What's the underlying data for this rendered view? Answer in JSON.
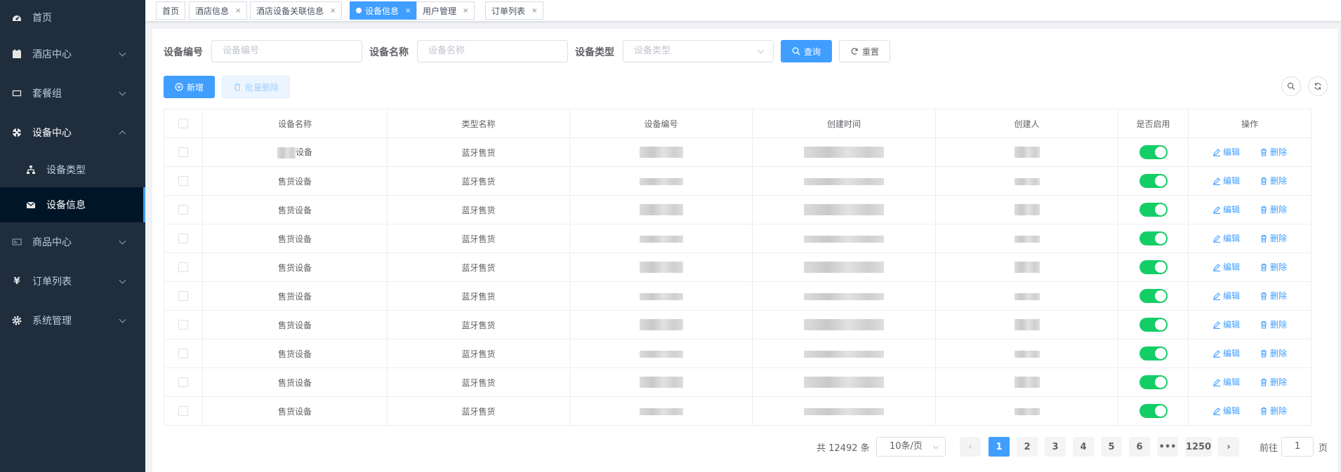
{
  "sidebar": {
    "items": [
      {
        "label": "首页",
        "icon": "dashboard-icon"
      },
      {
        "label": "酒店中心",
        "icon": "hotel-icon"
      },
      {
        "label": "套餐组",
        "icon": "package-icon"
      },
      {
        "label": "设备中心",
        "icon": "device-icon"
      },
      {
        "label": "商品中心",
        "icon": "goods-icon"
      },
      {
        "label": "订单列表",
        "icon": "yen-icon"
      },
      {
        "label": "系统管理",
        "icon": "gear-icon"
      }
    ],
    "sub_items": [
      {
        "label": "设备类型",
        "icon": "tree-icon"
      },
      {
        "label": "设备信息",
        "icon": "mail-icon"
      }
    ],
    "active_sub": "设备信息"
  },
  "tabs": [
    {
      "label": "首页"
    },
    {
      "label": "酒店信息"
    },
    {
      "label": "酒店设备关联信息"
    },
    {
      "label": "设备信息"
    },
    {
      "label": "用户管理"
    },
    {
      "label": "订单列表"
    }
  ],
  "filters": {
    "device_code_label": "设备编号",
    "device_code_placeholder": "设备编号",
    "device_name_label": "设备名称",
    "device_name_placeholder": "设备名称",
    "device_type_label": "设备类型",
    "device_type_placeholder": "设备类型",
    "search_label": "查询",
    "reset_label": "重置"
  },
  "toolbar": {
    "add_label": "新增",
    "batch_delete_label": "批量删除"
  },
  "table": {
    "columns": [
      "设备名称",
      "类型名称",
      "设备编号",
      "创建时间",
      "创建人",
      "是否启用",
      "操作"
    ],
    "rows": [
      {
        "name": "设备",
        "type": "蓝牙售货"
      },
      {
        "name": "售货设备",
        "type": "蓝牙售货"
      },
      {
        "name": "售货设备",
        "type": "蓝牙售货"
      },
      {
        "name": "售货设备",
        "type": "蓝牙售货"
      },
      {
        "name": "售货设备",
        "type": "蓝牙售货"
      },
      {
        "name": "售货设备",
        "type": "蓝牙售货"
      },
      {
        "name": "售货设备",
        "type": "蓝牙售货"
      },
      {
        "name": "售货设备",
        "type": "蓝牙售货"
      },
      {
        "name": "售货设备",
        "type": "蓝牙售货"
      },
      {
        "name": "售货设备",
        "type": "蓝牙售货"
      }
    ],
    "edit_label": "编辑",
    "delete_label": "删除"
  },
  "pagination": {
    "total_text": "共 12492 条",
    "page_size": "10条/页",
    "pages": [
      "1",
      "2",
      "3",
      "4",
      "5",
      "6",
      "•••",
      "1250"
    ],
    "goto_prefix": "前往",
    "goto_value": "1",
    "goto_suffix": "页"
  },
  "colors": {
    "primary": "#409eff",
    "sidebar": "#1f2d3d",
    "switch_on": "#13ce66"
  }
}
